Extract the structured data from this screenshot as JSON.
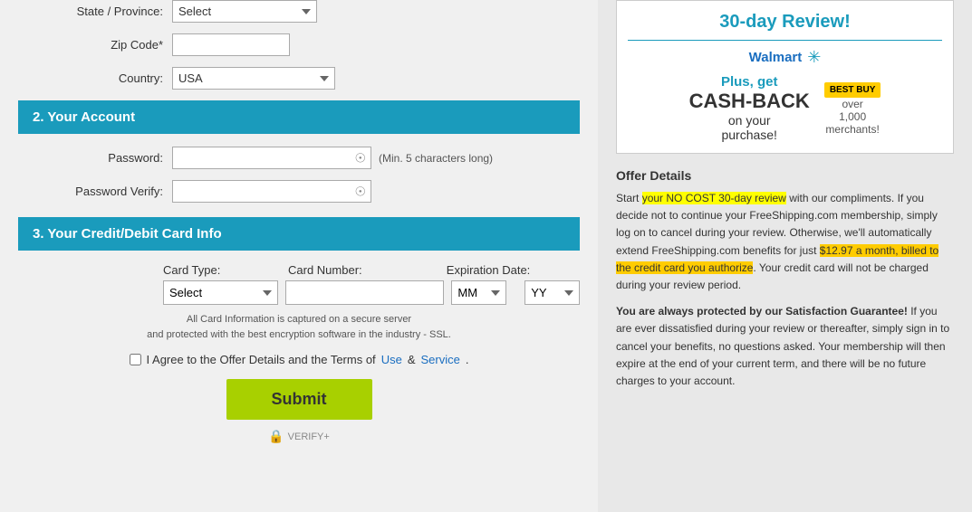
{
  "form": {
    "state_label": "State / Province:",
    "state_placeholder": "Select",
    "zip_label": "Zip Code",
    "zip_required": true,
    "country_label": "Country:",
    "country_required": true,
    "country_value": "USA",
    "section2_title": "2. Your Account",
    "password_label": "Password:",
    "password_min_note": "(Min. 5 characters long)",
    "password_verify_label": "Password Verify:",
    "section3_title": "3. Your Credit/Debit Card Info",
    "card_type_label": "Card Type:",
    "card_number_label": "Card Number:",
    "exp_date_label": "Expiration Date:",
    "card_type_placeholder": "Select",
    "exp_mm_placeholder": "MM",
    "exp_yy_placeholder": "YY",
    "ssl_line1": "All Card Information is captured on a secure server",
    "ssl_line2": "and protected with the best encryption software in the industry - SSL.",
    "agree_text": "I Agree to the Offer Details and the Terms of",
    "agree_use": "Use",
    "agree_ampersand": "&",
    "agree_service": "Service",
    "agree_period": ".",
    "submit_label": "Submit",
    "verify_label": "VERIFY+"
  },
  "ad": {
    "review_title": "30-day Review!",
    "walmart_label": "Walmart",
    "bestbuy_badge": "BEST BUY",
    "cashback_plus": "Plus, get",
    "cashback_main": "CASH-BACK",
    "cashback_on": "on your",
    "cashback_purchase": "purchase!",
    "cashback_over": "over",
    "cashback_merchants": "1,000",
    "cashback_merchants2": "merchants!"
  },
  "offer": {
    "title": "Offer Details",
    "text_before_highlight1": "Start ",
    "highlight1": "your NO COST 30-day review",
    "text_after_highlight1": " with our compliments. If you decide not to continue your FreeShipping.com membership, simply log on to cancel during your review. Otherwise, we'll automatically extend FreeShipping.com benefits for just ",
    "highlight2": "$12.97 a month, billed to the credit card you authorize",
    "text_after_highlight2": ". Your credit card will not be charged during your review period.",
    "para2_bold_start": "You are always protected by our Satisfaction Guarantee!",
    "para2_rest": " If you are ever dissatisfied during your review or thereafter, simply sign in to cancel your benefits, no questions asked. Your membership will then expire at the end of your current term, and there will be no future charges to your account."
  }
}
